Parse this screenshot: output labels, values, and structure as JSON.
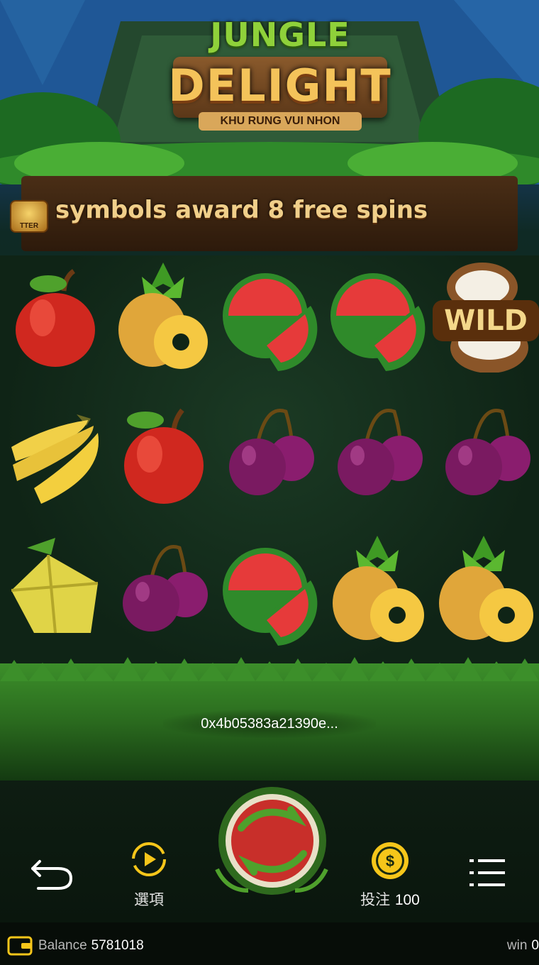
{
  "game": {
    "logo_line1": "JUNGLE",
    "logo_line2": "DELIGHT",
    "logo_subtitle": "KHU RUNG VUI NHON"
  },
  "banner": {
    "message": "symbols award 8 free spins",
    "scatter_badge": "TTER"
  },
  "reels": {
    "rows": [
      [
        "apple-icon",
        "pineapple-icon",
        "watermelon-icon",
        "watermelon-icon",
        "wild-coconut-icon"
      ],
      [
        "banana-icon",
        "apple-icon",
        "plum-icon",
        "plum-icon",
        "plum-icon"
      ],
      [
        "starfruit-icon",
        "plum-icon",
        "watermelon-icon",
        "pineapple-icon",
        "pineapple-icon"
      ]
    ],
    "wild_label": "WILD"
  },
  "transaction": {
    "hash": "0x4b05383a21390e..."
  },
  "controls": {
    "options_label": "選項",
    "bet_label": "投注",
    "bet_value": "100"
  },
  "status": {
    "balance_label": "Balance",
    "balance_value": "5781018",
    "win_label": "win",
    "win_value": "0"
  },
  "colors": {
    "accent_gold": "#f6c61a",
    "leaf_green": "#3c8f2a",
    "text_white": "#ffffff"
  }
}
